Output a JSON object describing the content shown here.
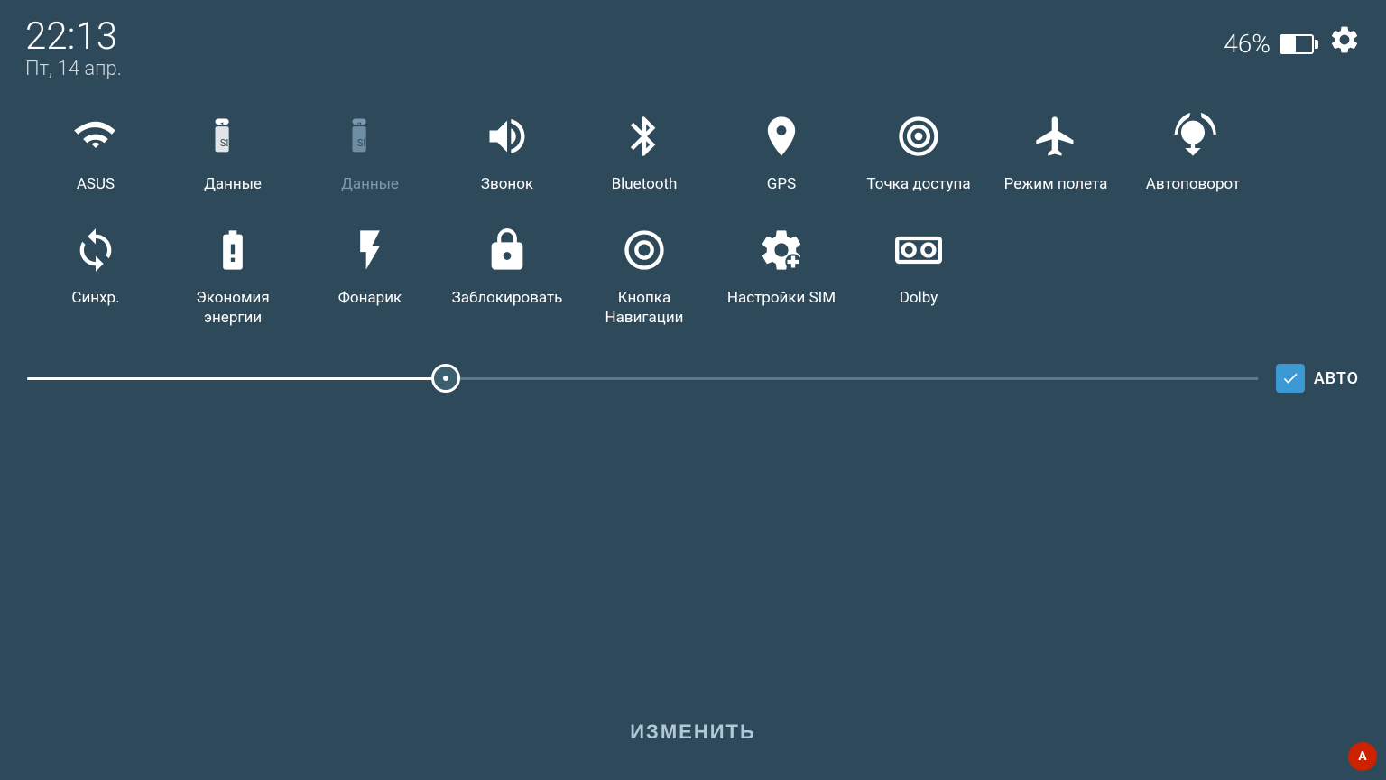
{
  "header": {
    "time": "22:13",
    "date": "Пт, 14 апр.",
    "battery_percent": "46%",
    "settings_label": "⚙"
  },
  "toggles_row1": [
    {
      "id": "wifi",
      "label": "ASUS",
      "active": true
    },
    {
      "id": "data1",
      "label": "Данные",
      "active": true
    },
    {
      "id": "data2",
      "label": "Данные",
      "active": false
    },
    {
      "id": "sound",
      "label": "Звонок",
      "active": true
    },
    {
      "id": "bluetooth",
      "label": "Bluetooth",
      "active": true
    },
    {
      "id": "gps",
      "label": "GPS",
      "active": true
    },
    {
      "id": "hotspot",
      "label": "Точка доступа",
      "active": true
    },
    {
      "id": "airplane",
      "label": "Режим полета",
      "active": true
    },
    {
      "id": "rotation",
      "label": "Автоповорот",
      "active": true
    }
  ],
  "toggles_row2": [
    {
      "id": "sync",
      "label": "Синхр.",
      "active": true
    },
    {
      "id": "battery_save",
      "label": "Экономия энергии",
      "active": true
    },
    {
      "id": "flashlight",
      "label": "Фонарик",
      "active": true
    },
    {
      "id": "lock_screen",
      "label": "Заблокировать",
      "active": true
    },
    {
      "id": "nav_button",
      "label": "Кнопка Навигации",
      "active": true
    },
    {
      "id": "sim_settings",
      "label": "Настройки SIM",
      "active": true
    },
    {
      "id": "dolby",
      "label": "Dolby",
      "active": true
    }
  ],
  "brightness": {
    "value": 34,
    "auto_label": "АВТО",
    "auto_checked": true
  },
  "change_button": "ИЗМЕНИТЬ"
}
